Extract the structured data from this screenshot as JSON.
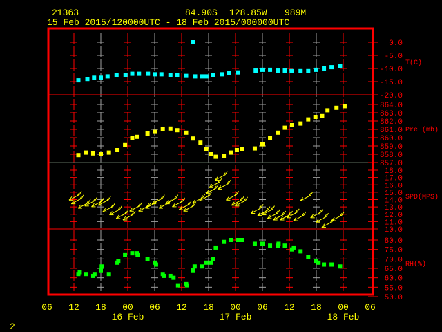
{
  "header": {
    "station": "21363",
    "lat": "84.90S",
    "lon": "128.85W",
    "elev": "989M",
    "period": "15 Feb 2015/120000UTC - 18 Feb 2015/000000UTC"
  },
  "footer": {
    "page": "2"
  },
  "colors": {
    "frame": "#ff0000",
    "text": "#ffff00",
    "temp": "#00ffff",
    "pres": "#ffff00",
    "wind": "#ffff00",
    "rh": "#00ff00",
    "grid_alt": "#a0a0a0"
  },
  "chart_data": {
    "type": "scatter",
    "x_unit": "hours since 15 Feb 2015 06 UTC",
    "x_ticks": [
      "06",
      "12",
      "18",
      "00",
      "06",
      "12",
      "18",
      "00",
      "06",
      "12",
      "18",
      "00",
      "06"
    ],
    "x_dates": [
      {
        "label": "16 Feb",
        "hour": 18
      },
      {
        "label": "17 Feb",
        "hour": 42
      },
      {
        "label": "18 Feb",
        "hour": 66
      }
    ],
    "panels": [
      {
        "name": "T(C)",
        "ylim": [
          -20,
          0
        ],
        "ticks": [
          "0.0",
          "-5.0",
          "-10.0",
          "-15.0",
          "-20.0"
        ],
        "tick_values": [
          0,
          -5,
          -10,
          -15,
          -20
        ],
        "points": [
          [
            7,
            -14.5
          ],
          [
            9,
            -14
          ],
          [
            10.5,
            -13.5
          ],
          [
            12,
            -13.5
          ],
          [
            13.5,
            -13
          ],
          [
            15.5,
            -12.5
          ],
          [
            17.5,
            -12.5
          ],
          [
            19,
            -12
          ],
          [
            20.5,
            -12
          ],
          [
            22.5,
            -12
          ],
          [
            24,
            -12.2
          ],
          [
            25.5,
            -12.2
          ],
          [
            27.5,
            -12.5
          ],
          [
            29,
            -12.5
          ],
          [
            31,
            -12.8
          ],
          [
            32.6,
            0
          ],
          [
            33,
            -13
          ],
          [
            34.5,
            -13
          ],
          [
            35.5,
            -13
          ],
          [
            37,
            -12.5
          ],
          [
            39,
            -12.2
          ],
          [
            40.5,
            -11.8
          ],
          [
            42.5,
            -11.5
          ],
          [
            46.5,
            -10.8
          ],
          [
            48,
            -10.5
          ],
          [
            49.7,
            -10.5
          ],
          [
            51.5,
            -10.8
          ],
          [
            53,
            -10.8
          ],
          [
            54.5,
            -11
          ],
          [
            56.5,
            -11
          ],
          [
            58.2,
            -11
          ],
          [
            60,
            -10.5
          ],
          [
            61.7,
            -10
          ],
          [
            63.4,
            -9.5
          ],
          [
            65.3,
            -9
          ]
        ]
      },
      {
        "name": "Pre (mb)",
        "ylim": [
          857,
          864
        ],
        "ticks": [
          "864.0",
          "863.0",
          "862.0",
          "861.0",
          "860.0",
          "859.0",
          "858.0",
          "857.0"
        ],
        "tick_values": [
          864,
          863,
          862,
          861,
          860,
          859,
          858,
          857
        ],
        "points": [
          [
            7,
            857.9
          ],
          [
            8.7,
            858.2
          ],
          [
            10.3,
            858.1
          ],
          [
            12,
            858
          ],
          [
            13.8,
            858.2
          ],
          [
            15.7,
            858.5
          ],
          [
            17.4,
            859.1
          ],
          [
            19,
            860
          ],
          [
            20,
            860.1
          ],
          [
            22.4,
            860.5
          ],
          [
            24,
            860.7
          ],
          [
            25.8,
            861
          ],
          [
            27.5,
            861.1
          ],
          [
            29,
            860.9
          ],
          [
            31,
            860.6
          ],
          [
            32.6,
            859.9
          ],
          [
            34.2,
            859.4
          ],
          [
            35.5,
            858.6
          ],
          [
            36.5,
            858
          ],
          [
            37.6,
            857.7
          ],
          [
            39.4,
            857.8
          ],
          [
            41,
            858.2
          ],
          [
            42.3,
            858.5
          ],
          [
            43.5,
            858.6
          ],
          [
            46.3,
            858.7
          ],
          [
            48,
            859.2
          ],
          [
            49.7,
            860
          ],
          [
            51.4,
            860.6
          ],
          [
            53,
            861.2
          ],
          [
            54.6,
            861.5
          ],
          [
            56.5,
            861.7
          ],
          [
            58.2,
            862.2
          ],
          [
            59.8,
            862.5
          ],
          [
            61.3,
            862.6
          ],
          [
            62.5,
            863.3
          ],
          [
            64.5,
            863.6
          ],
          [
            66.3,
            863.8
          ]
        ]
      },
      {
        "name": "SPD(MPS)",
        "ylim": [
          10,
          18
        ],
        "ticks": [
          "18.0",
          "17.0",
          "16.0",
          "15.0",
          "14.0",
          "13.0",
          "12.0",
          "11.0",
          "10.0"
        ],
        "tick_values": [
          18,
          17,
          16,
          15,
          14,
          13,
          12,
          11,
          10
        ],
        "wind_dir_from_deg": 45,
        "points": [
          [
            6,
            14.3
          ],
          [
            6.5,
            13.8
          ],
          [
            8,
            13.2
          ],
          [
            9.5,
            13.5
          ],
          [
            11,
            13.4
          ],
          [
            12.5,
            13.6
          ],
          [
            13.5,
            12.7
          ],
          [
            15,
            12.3
          ],
          [
            16.5,
            11.8
          ],
          [
            18,
            11.6
          ],
          [
            19.5,
            12.8
          ],
          [
            21.5,
            12.8
          ],
          [
            23,
            13.2
          ],
          [
            24.5,
            13.8
          ],
          [
            26,
            13.2
          ],
          [
            27.5,
            13.8
          ],
          [
            29,
            13.4
          ],
          [
            30.5,
            13
          ],
          [
            31.5,
            12.8
          ],
          [
            33.5,
            13.9
          ],
          [
            35,
            14.2
          ],
          [
            36.5,
            15.2
          ],
          [
            37.2,
            16
          ],
          [
            38.5,
            17
          ],
          [
            39.2,
            15.8
          ],
          [
            41,
            14.3
          ],
          [
            42.2,
            13.6
          ],
          [
            43,
            13.5
          ],
          [
            46.5,
            12.5
          ],
          [
            48,
            12.2
          ],
          [
            49,
            12.3
          ],
          [
            50.2,
            11.8
          ],
          [
            51.5,
            11.6
          ],
          [
            53,
            11.6
          ],
          [
            54.5,
            11.9
          ],
          [
            56,
            11.5
          ],
          [
            57.5,
            14.2
          ],
          [
            59.8,
            11.9
          ],
          [
            61,
            11.3
          ],
          [
            62.3,
            10.6
          ],
          [
            64.5,
            11.5
          ]
        ]
      },
      {
        "name": "RH(%)",
        "ylim": [
          50,
          80
        ],
        "ticks": [
          "80.0",
          "75.0",
          "70.0",
          "65.0",
          "60.0",
          "55.0",
          "50.0"
        ],
        "tick_values": [
          80,
          75,
          70,
          65,
          60,
          55,
          50
        ],
        "points": [
          [
            7,
            62
          ],
          [
            7.3,
            63
          ],
          [
            8.7,
            62
          ],
          [
            10.3,
            61
          ],
          [
            10.6,
            62
          ],
          [
            12,
            64
          ],
          [
            12.2,
            66
          ],
          [
            13.8,
            62
          ],
          [
            15.7,
            68
          ],
          [
            15.9,
            69
          ],
          [
            17.4,
            72
          ],
          [
            19,
            73
          ],
          [
            20,
            73
          ],
          [
            20.2,
            72
          ],
          [
            22.4,
            70
          ],
          [
            24,
            68
          ],
          [
            24.3,
            67
          ],
          [
            25.8,
            62
          ],
          [
            26,
            61
          ],
          [
            27.5,
            61
          ],
          [
            28.2,
            60
          ],
          [
            29.2,
            56
          ],
          [
            31,
            57
          ],
          [
            31.2,
            56
          ],
          [
            32.6,
            64
          ],
          [
            32.9,
            66
          ],
          [
            34.5,
            66
          ],
          [
            35.5,
            68
          ],
          [
            36.5,
            68
          ],
          [
            37,
            70
          ],
          [
            37.6,
            76
          ],
          [
            39.4,
            79
          ],
          [
            41,
            80
          ],
          [
            42.5,
            80
          ],
          [
            43.5,
            80
          ],
          [
            46.3,
            78
          ],
          [
            48,
            78
          ],
          [
            49.7,
            77
          ],
          [
            51.4,
            77
          ],
          [
            51.6,
            78
          ],
          [
            53,
            77
          ],
          [
            54.6,
            75
          ],
          [
            55,
            76
          ],
          [
            56.5,
            74
          ],
          [
            58.2,
            71
          ],
          [
            60,
            69
          ],
          [
            60.5,
            68
          ],
          [
            61.7,
            67
          ],
          [
            63.4,
            67
          ],
          [
            65.3,
            66
          ]
        ]
      }
    ]
  }
}
